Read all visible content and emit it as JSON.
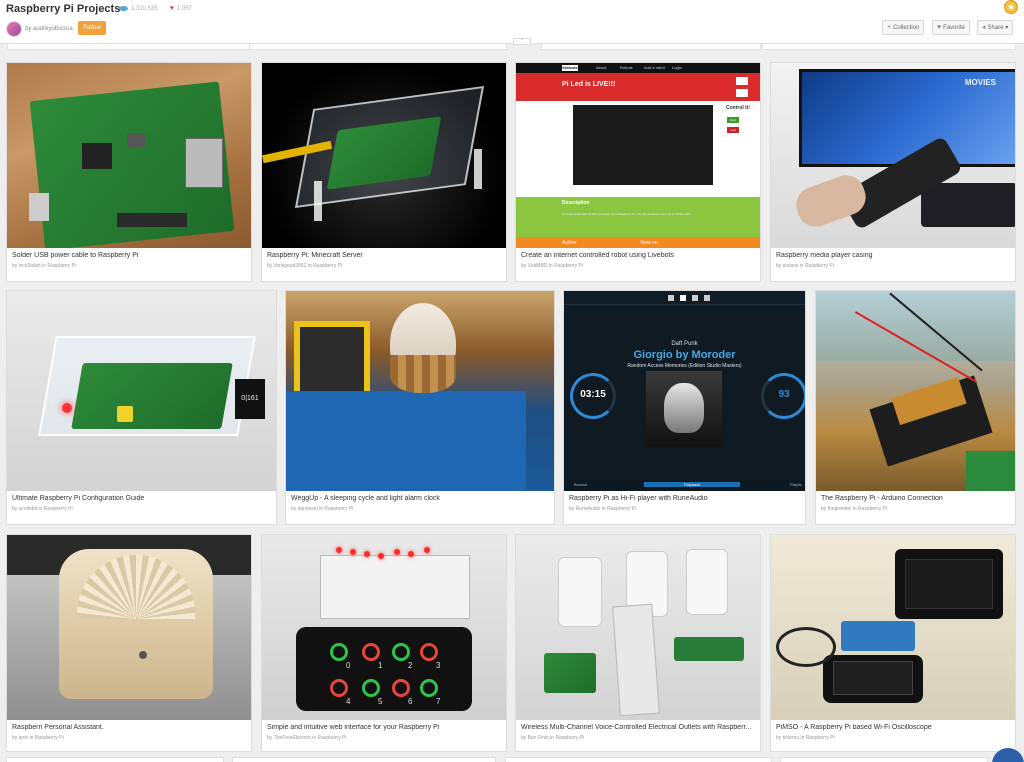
{
  "header": {
    "title": "Raspberry Pi Projects",
    "views": "1,310,535",
    "favorites": "1,057",
    "byline": "by audreyobscura",
    "follow_label": "Follow",
    "collection_label": "Collection",
    "favorite_label": "Favorite",
    "share_label": "Share",
    "collapse_symbol": "^"
  },
  "cards": [
    {
      "caption": "Solder USB power cable to Raspberry Pi",
      "author": "ivch3isiah",
      "category": "Raspberry Pi"
    },
    {
      "caption": "Raspberry Pi: Minecraft Server",
      "author": "chrisgoud3862",
      "category": "Raspberry Pi"
    },
    {
      "caption": "Create an internet controlled robot using Livebots",
      "author": "XiotMBD",
      "category": "Raspberry Pi"
    },
    {
      "caption": "Raspberry media player casing",
      "author": "anweis",
      "category": "Raspberry Pi"
    },
    {
      "caption": "Ultimate Raspberry Pi Configuration Guide",
      "author": "scottsbtl",
      "category": "Raspberry Pi"
    },
    {
      "caption": "WeggUp - A sleeping cycle and light alarm clock",
      "author": "darwasel",
      "category": "Raspberry Pi"
    },
    {
      "caption": "Raspberry Pi as Hi-Fi player with RuneAudio",
      "author": "RuneAudio",
      "category": "Raspberry Pi"
    },
    {
      "caption": "The Raspberry Pi - Arduino Connection",
      "author": "thegrendel",
      "category": "Raspberry Pi"
    },
    {
      "caption": "Raspberri Personal Assistant.",
      "author": "jane",
      "category": "Raspberry Pi"
    },
    {
      "caption": "Simple and intuitive web interface for your Raspberry Pi",
      "author": "TheFreeElectron",
      "category": "Raspberry Pi"
    },
    {
      "caption": "Wireless Multi-Channel Voice-Controlled Electrical Outlets with Raspberr...",
      "author": "Ben Finio",
      "category": "Raspberry Pi"
    },
    {
      "caption": "PiMSO - A Raspberry Pi based Wi-Fi Oscilloscope",
      "author": "tinkrma",
      "category": "Raspberry Pi"
    }
  ],
  "in_word": "in",
  "livebots": {
    "logo": "livebots",
    "nav": [
      "About",
      "Robots",
      "Add a robot",
      "Login"
    ],
    "headline": "Pi Led is LIVE!!!",
    "control": "Control it!",
    "on": "Red",
    "off": "Led",
    "description_title": "Description",
    "description_text": "A simple robot with a LED controlled by a Raspberry Pi. Use the buttons to turn on or off the LED.",
    "author_label": "Author",
    "view_label": "View on"
  },
  "tv": {
    "screen_text": "MOVIES"
  },
  "runeaudio": {
    "artist": "Daft Punk",
    "song": "Giorgio by Moroder",
    "album": "Random Access Memories (Edition Studio Masters)",
    "playlist": "Playlist position 00/18",
    "format": "Stereo, 24 bit, 96.0 kHz, 2717 kbps",
    "clock": "03:15",
    "clock_sub": "03:15",
    "volume": "93",
    "browse": "Browse",
    "playback": "Playback",
    "playlist_tab": "Playlis"
  },
  "webui": {
    "numbers": [
      "0",
      "1",
      "2",
      "3",
      "4",
      "5",
      "6",
      "7"
    ]
  },
  "colors": {
    "follow": "#f1a23a",
    "heart": "#e0357a",
    "views": "#5aa7d9",
    "accent_blue": "#2c8ad8"
  }
}
